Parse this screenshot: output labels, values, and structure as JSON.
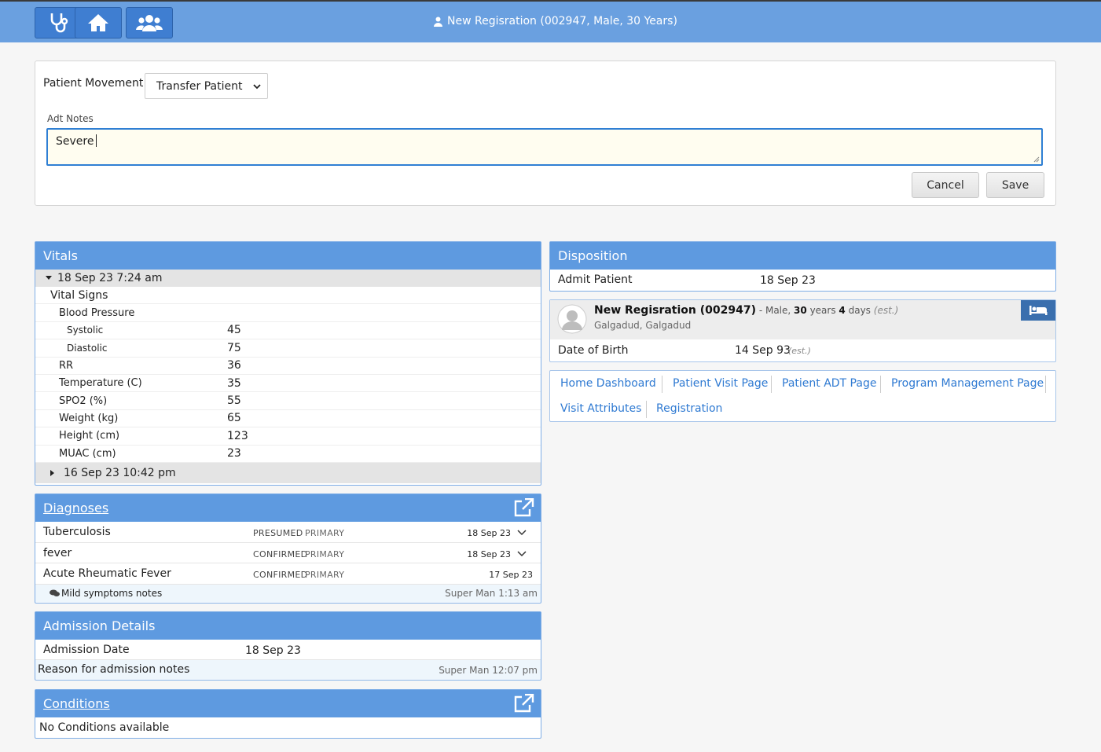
{
  "header": {
    "title": "New Regisration (002947, Male, 30 Years)",
    "nav_icons": [
      "stethoscope-icon",
      "home-icon",
      "users-icon"
    ]
  },
  "adt_form": {
    "movement_label": "Patient Movement:",
    "movement_value": "Transfer Patient",
    "notes_label": "Adt Notes",
    "notes_value": "Severe",
    "cancel_label": "Cancel",
    "save_label": "Save"
  },
  "vitals": {
    "title": "Vitals",
    "open_date": "18 Sep 23 7:24 am",
    "group": "Vital Signs",
    "subgroup": "Blood Pressure",
    "items": [
      {
        "label": "Systolic",
        "value": "45"
      },
      {
        "label": "Diastolic",
        "value": "75"
      },
      {
        "label": "RR",
        "value": "36"
      },
      {
        "label": "Temperature (C)",
        "value": "35"
      },
      {
        "label": "SPO2 (%)",
        "value": "55"
      },
      {
        "label": "Weight (kg)",
        "value": "65"
      },
      {
        "label": "Height (cm)",
        "value": "123"
      },
      {
        "label": "MUAC (cm)",
        "value": "23"
      }
    ],
    "closed_date": "16 Sep 23 10:42 pm"
  },
  "diagnoses": {
    "title": "Diagnoses",
    "rows": [
      {
        "name": "Tuberculosis",
        "certainty": "PRESUMED",
        "order": "PRIMARY",
        "date": "18 Sep 23"
      },
      {
        "name": "fever",
        "certainty": "CONFIRMED",
        "order": "PRIMARY",
        "date": "18 Sep 23"
      },
      {
        "name": "Acute Rheumatic Fever",
        "certainty": "CONFIRMED",
        "order": "PRIMARY",
        "date": "17 Sep 23"
      }
    ],
    "note_text": "Mild symptoms notes",
    "note_meta": "Super Man 1:13 am"
  },
  "admission": {
    "title": "Admission Details",
    "date_label": "Admission Date",
    "date_value": "18 Sep 23",
    "notes_label": "Reason for admission notes",
    "notes_meta": "Super Man 12:07 pm"
  },
  "conditions": {
    "title": "Conditions",
    "empty": "No Conditions available"
  },
  "disposition": {
    "title": "Disposition",
    "label": "Admit Patient",
    "value": "18 Sep 23"
  },
  "patient": {
    "name": "New Regisration (002947)",
    "sep": " - Male,",
    "years_num": "30",
    "years_word": "years",
    "days_num": "4",
    "days_word": "days",
    "est": "(est.)",
    "location": "Galgadud, Galgadud",
    "dob_label": "Date of Birth",
    "dob_value": "14 Sep 93",
    "dob_est": "(est.)"
  },
  "links": [
    "Home Dashboard",
    "Patient Visit Page",
    "Patient ADT Page",
    "Program Management Page",
    "Visit Attributes",
    "Registration"
  ]
}
